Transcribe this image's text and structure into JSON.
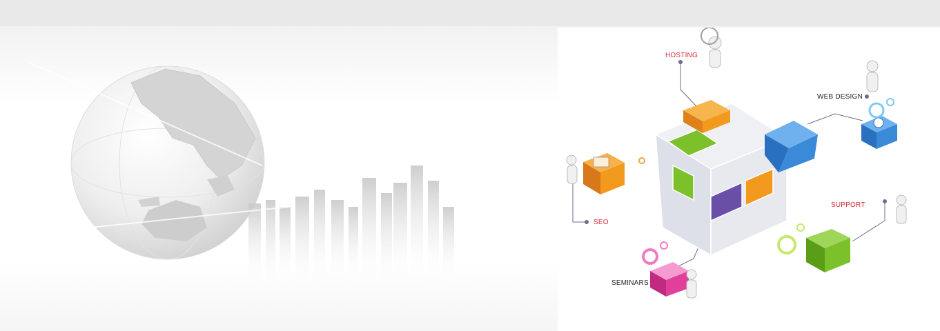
{
  "services": {
    "hosting": "HOSTING",
    "web_design": "WEB DESIGN",
    "seo": "SEO",
    "support": "SUPPORT",
    "seminars": "SEMINARS"
  },
  "colors": {
    "orange": "#f19a1e",
    "blue": "#3b8ad8",
    "green": "#7cc02a",
    "purple": "#6a4fa8",
    "pink": "#e0409a",
    "label_red": "#d8283a"
  },
  "icons": {
    "globe": "globe-icon",
    "skyline": "city-skyline",
    "cube": "cube-graphic"
  }
}
